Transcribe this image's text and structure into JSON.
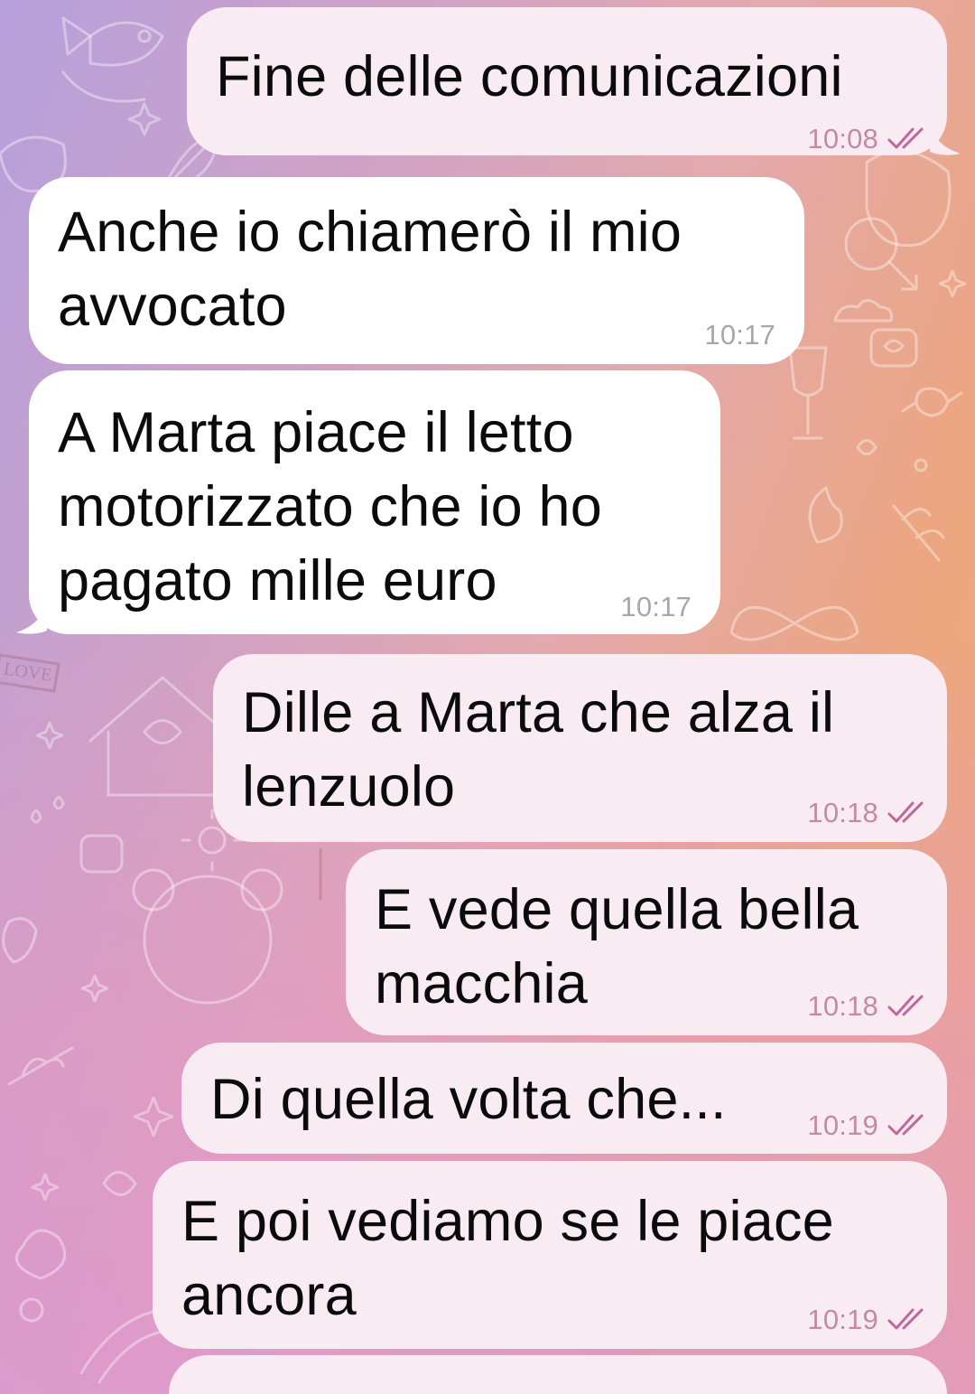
{
  "messages": [
    {
      "direction": "out",
      "lines": [
        "Fine delle comunicazioni"
      ],
      "time": "10:08",
      "status": "read"
    },
    {
      "direction": "in",
      "lines": [
        "Anche io chiamerò il mio",
        "avvocato"
      ],
      "time": "10:17"
    },
    {
      "direction": "in",
      "lines": [
        "A Marta piace il letto",
        "motorizzato che io ho",
        "pagato mille euro"
      ],
      "time": "10:17"
    },
    {
      "direction": "out",
      "lines": [
        "Dille a Marta che alza il",
        "lenzuolo"
      ],
      "time": "10:18",
      "status": "read"
    },
    {
      "direction": "out",
      "lines": [
        "E vede quella bella",
        "macchia"
      ],
      "time": "10:18",
      "status": "read"
    },
    {
      "direction": "out",
      "lines": [
        "Di quella volta che..."
      ],
      "time": "10:19",
      "status": "read"
    },
    {
      "direction": "out",
      "lines": [
        "E poi vediamo se le piace",
        "ancora"
      ],
      "time": "10:19",
      "status": "read"
    }
  ],
  "wallpaper": {
    "banner_text": "LOVE"
  },
  "colors": {
    "outgoing_bubble": "#f8ebf1",
    "incoming_bubble": "#ffffff",
    "read_checks": "#c0669a",
    "outgoing_time": "#c38aa6",
    "incoming_time": "#a7a7a7"
  },
  "icons": {
    "read_status": "double-check-icon"
  }
}
